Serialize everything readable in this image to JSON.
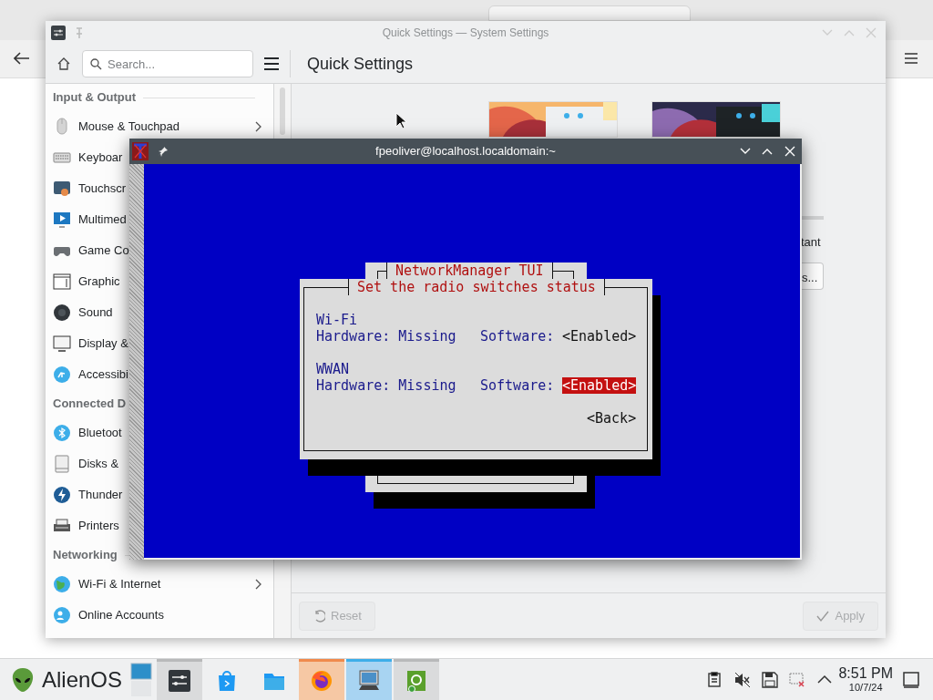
{
  "settings": {
    "title": "Quick Settings — System Settings",
    "search": {
      "placeholder": "Search..."
    },
    "heading": "Quick Settings",
    "sidebar": [
      {
        "section": "Input & Output",
        "items": [
          {
            "label": "Mouse & Touchpad",
            "kind": "mouse",
            "chevron": true
          },
          {
            "label": "Keyboar",
            "kind": "keyboard",
            "chevron": false
          },
          {
            "label": "Touchscr",
            "kind": "touchscreen",
            "chevron": false
          },
          {
            "label": "Multimed",
            "kind": "multimedia",
            "chevron": false
          },
          {
            "label": "Game Co",
            "kind": "gamepad",
            "chevron": false
          },
          {
            "label": "Graphic",
            "kind": "tablet",
            "chevron": false
          },
          {
            "label": "Sound",
            "kind": "sound",
            "chevron": false
          },
          {
            "label": "Display &",
            "kind": "display",
            "chevron": false
          },
          {
            "label": "Accessibi",
            "kind": "accessibility",
            "chevron": false
          }
        ]
      },
      {
        "section": "Connected D",
        "items": [
          {
            "label": "Bluetoot",
            "kind": "bluetooth",
            "chevron": false
          },
          {
            "label": "Disks &",
            "kind": "disk",
            "chevron": false
          },
          {
            "label": "Thunder",
            "kind": "thunderbolt",
            "chevron": false
          },
          {
            "label": "Printers",
            "kind": "printer",
            "chevron": false
          }
        ]
      },
      {
        "section": "Networking",
        "items": [
          {
            "label": "Wi-Fi & Internet",
            "kind": "globe",
            "chevron": true
          },
          {
            "label": "Online Accounts",
            "kind": "accounts",
            "chevron": false
          }
        ]
      }
    ],
    "content": {
      "cut_label": "tant",
      "cut_button": "s..."
    },
    "footer": {
      "reset": {
        "label": "Reset",
        "disabled": true
      },
      "apply": {
        "label": "Apply",
        "disabled": true
      }
    }
  },
  "terminal": {
    "title": "fpeoliver@localhost.localdomain:~",
    "back_dialog_title": "NetworkManager TUI",
    "dialog": {
      "title": "Set the radio switches status",
      "radios": [
        {
          "name": "Wi-Fi",
          "hardware_label": "Hardware:",
          "hardware": "Missing",
          "software_label": "Software:",
          "software": "<Enabled>",
          "focused": false
        },
        {
          "name": "WWAN",
          "hardware_label": "Hardware:",
          "hardware": "Missing",
          "software_label": "Software:",
          "software": "<Enabled>",
          "focused": true
        }
      ],
      "back_button": "<Back>"
    }
  },
  "taskbar": {
    "launcher": "AlienOS",
    "tasks": [
      {
        "kind": "settings",
        "running": true,
        "attention": false,
        "selected": false
      },
      {
        "kind": "store",
        "running": false,
        "attention": false,
        "selected": false
      },
      {
        "kind": "files",
        "running": false,
        "attention": false,
        "selected": false
      },
      {
        "kind": "browser",
        "running": false,
        "attention": true,
        "selected": false
      },
      {
        "kind": "computer",
        "running": false,
        "attention": false,
        "selected": true
      },
      {
        "kind": "installer",
        "running": true,
        "attention": false,
        "selected": false
      }
    ],
    "tray": [
      {
        "kind": "clipboard"
      },
      {
        "kind": "muted"
      },
      {
        "kind": "save"
      },
      {
        "kind": "network-off"
      },
      {
        "kind": "expand"
      }
    ],
    "clock": {
      "time": "8:51 PM",
      "date": "10/7/24"
    }
  }
}
